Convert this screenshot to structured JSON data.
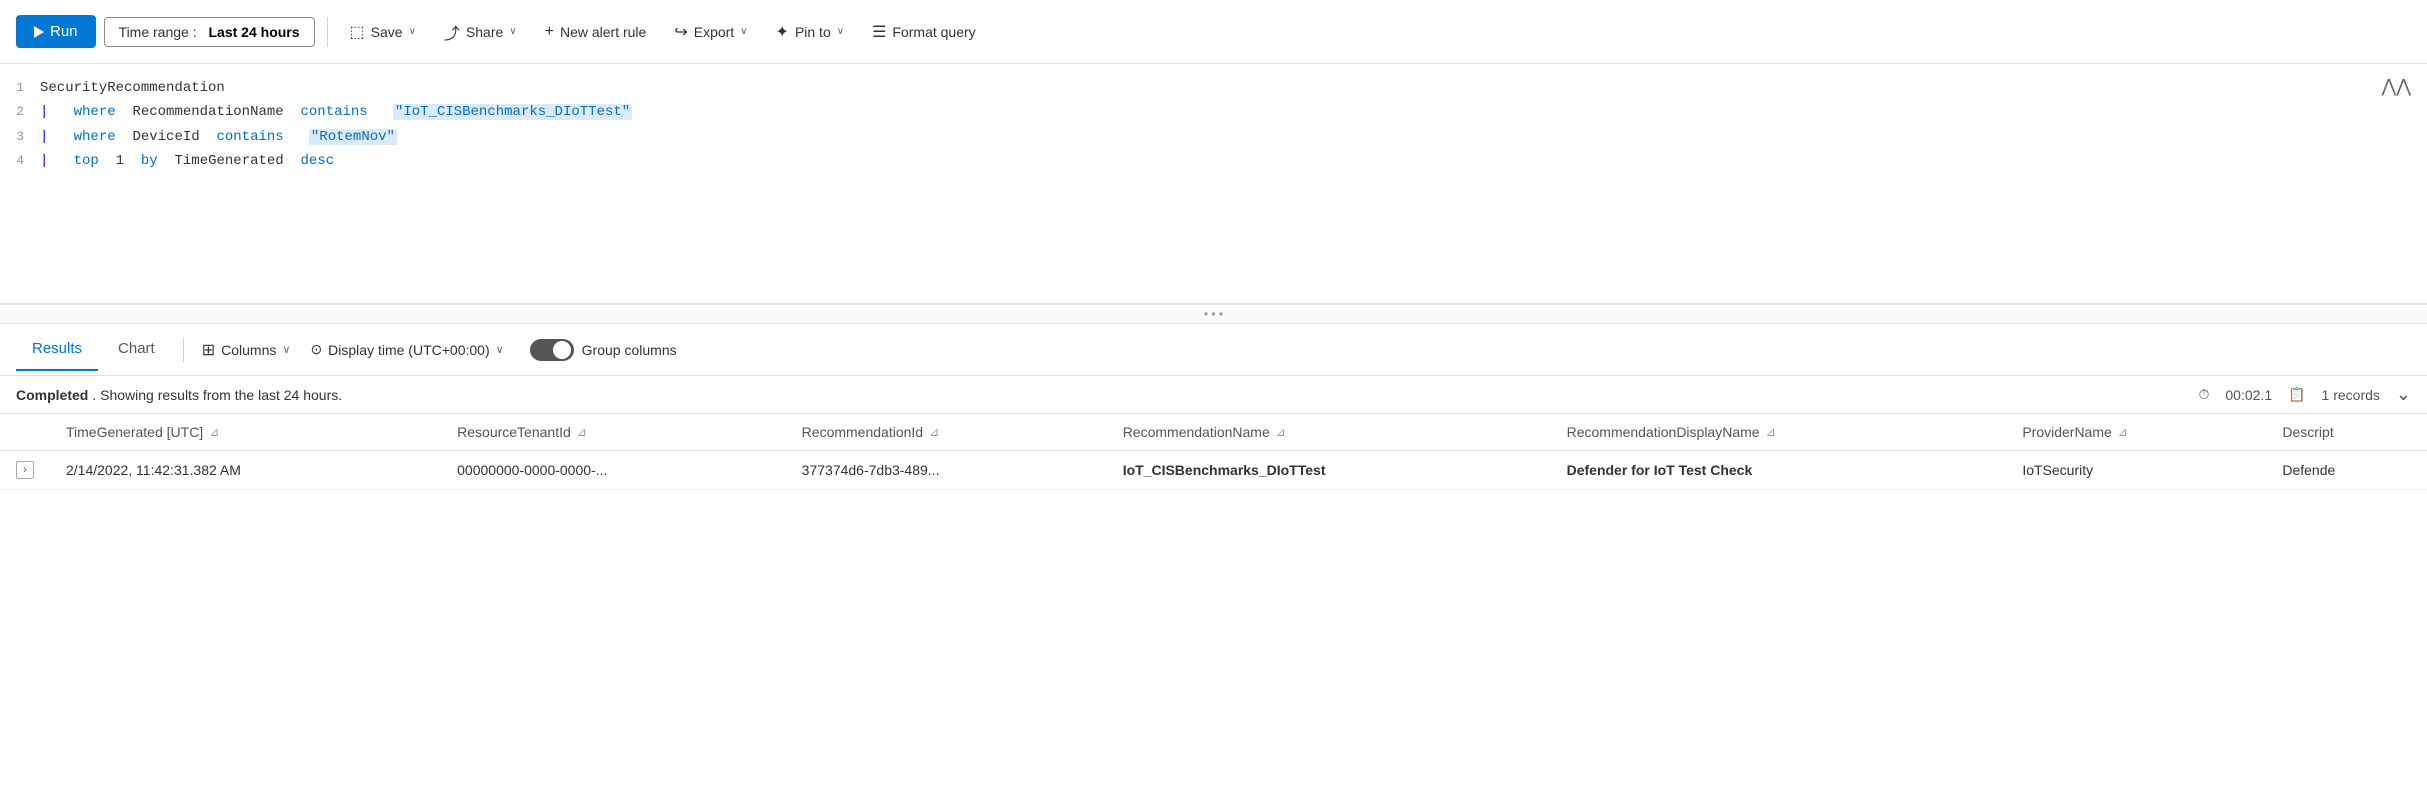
{
  "toolbar": {
    "run_label": "Run",
    "time_range_prefix": "Time range :",
    "time_range_value": "Last 24 hours",
    "save_label": "Save",
    "share_label": "Share",
    "new_alert_label": "New alert rule",
    "export_label": "Export",
    "pin_to_label": "Pin to",
    "format_query_label": "Format query"
  },
  "query": {
    "lines": [
      {
        "num": "1",
        "content": "SecurityRecommendation"
      },
      {
        "num": "2",
        "content": "| where RecommendationName contains \"IoT_CISBenchmarks_DIoTTest\""
      },
      {
        "num": "3",
        "content": "| where DeviceId contains \"RotemNov\""
      },
      {
        "num": "4",
        "content": "| top 1 by TimeGenerated desc"
      }
    ]
  },
  "results_tabs": {
    "results_label": "Results",
    "chart_label": "Chart",
    "columns_label": "Columns",
    "display_time_label": "Display time (UTC+00:00)",
    "group_columns_label": "Group columns"
  },
  "status": {
    "completed_label": "Completed",
    "message": ". Showing results from the last 24 hours.",
    "time": "00:02.1",
    "records": "1 records"
  },
  "table": {
    "columns": [
      "",
      "TimeGenerated [UTC]",
      "ResourceTenantId",
      "RecommendationId",
      "RecommendationName",
      "RecommendationDisplayName",
      "ProviderName",
      "Descript"
    ],
    "rows": [
      {
        "expand": ">",
        "TimeGenerated": "2/14/2022, 11:42:31.382 AM",
        "ResourceTenantId": "00000000-0000-0000-...",
        "RecommendationId": "377374d6-7db3-489...",
        "RecommendationName": "IoT_CISBenchmarks_DIoTTest",
        "RecommendationDisplayName": "Defender for IoT Test Check",
        "ProviderName": "IoTSecurity",
        "Descript": "Defende"
      }
    ]
  },
  "icons": {
    "play": "▶",
    "save": "💾",
    "share": "⬡",
    "plus": "+",
    "export": "↪",
    "pin": "📌",
    "format": "≡",
    "chevron_down": "∨",
    "columns_icon": "⊞",
    "clock_icon": "⏱",
    "records_icon": "📋",
    "chevron_expand": "⌄",
    "filter": "⊿",
    "dots": "...",
    "collapse_up": "⋀"
  }
}
